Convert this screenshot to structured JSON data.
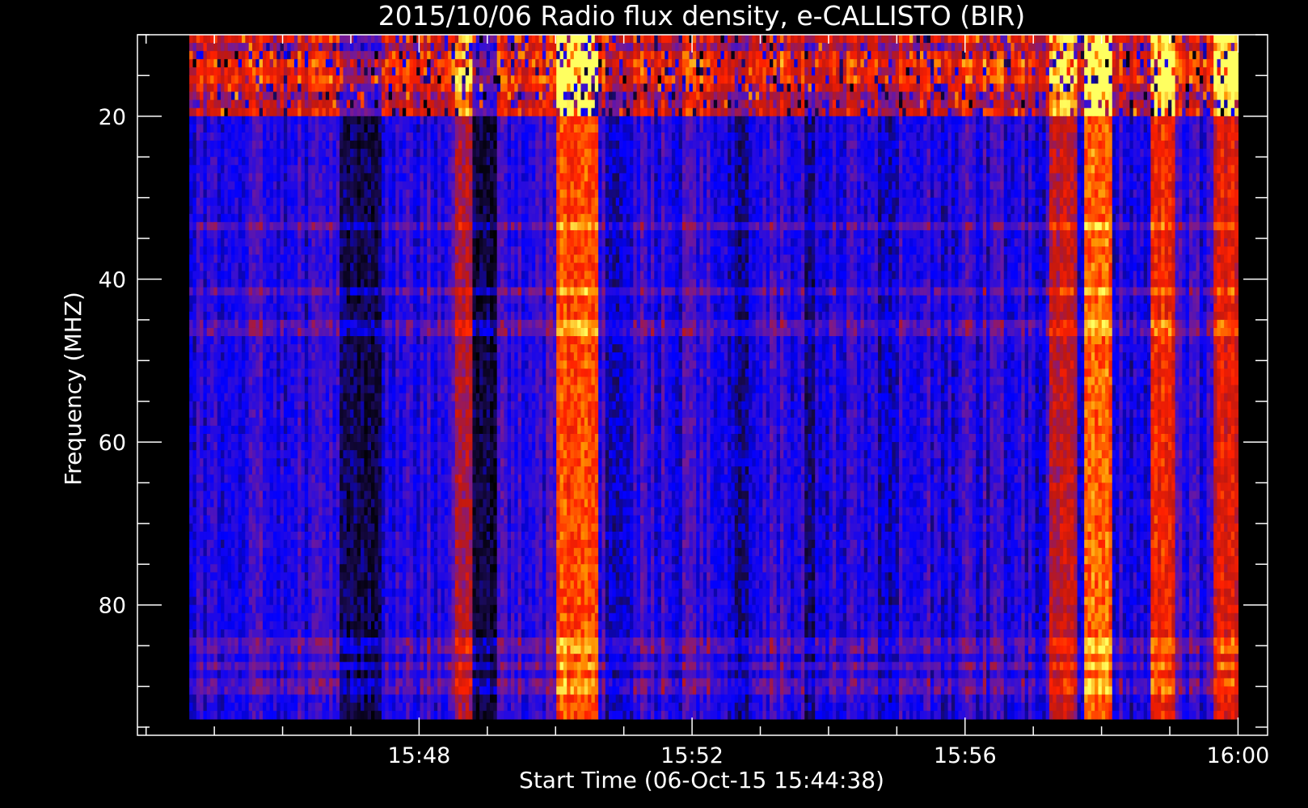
{
  "chart_data": {
    "type": "heatmap",
    "title": "2015/10/06  Radio flux density, e-CALLISTO (BIR)",
    "xlabel": "Start Time (06-Oct-15 15:44:38)",
    "ylabel": "Frequency (MHZ)",
    "x_ticks": [
      "15:48",
      "15:52",
      "15:56",
      "16:00"
    ],
    "y_ticks": [
      "20",
      "40",
      "60",
      "80"
    ],
    "y_tick_values": [
      20,
      40,
      60,
      80
    ],
    "x_tick_minutes": [
      3.367,
      7.367,
      11.367,
      15.367
    ],
    "xlim_minutes_after_start": [
      -0.76,
      15.8
    ],
    "ylim_mhz": [
      10,
      96
    ],
    "data_extent_mhz": [
      10,
      94
    ],
    "y_inverted": true,
    "colormap": [
      "#000000",
      "#1a0a55",
      "#0000ff",
      "#3a10d0",
      "#7a1a90",
      "#c01810",
      "#ff2000",
      "#ff9000",
      "#ffff60"
    ],
    "background_color": "#000000",
    "axis_color": "#ffffff",
    "bright_time_bands": [
      {
        "start_min": 5.4,
        "end_min": 6.0,
        "level": 0.78
      },
      {
        "start_min": 13.1,
        "end_min": 13.5,
        "level": 0.82
      },
      {
        "start_min": 14.1,
        "end_min": 14.45,
        "level": 0.72
      },
      {
        "start_min": 12.6,
        "end_min": 13.0,
        "level": 0.62
      },
      {
        "start_min": 15.0,
        "end_min": 15.4,
        "level": 0.68
      },
      {
        "start_min": 3.9,
        "end_min": 4.2,
        "level": 0.6
      }
    ],
    "dark_time_bands": [
      {
        "start_min": 2.2,
        "end_min": 2.8,
        "level": 0.08
      },
      {
        "start_min": 4.15,
        "end_min": 4.5,
        "level": 0.05
      },
      {
        "start_min": 6.1,
        "end_min": 6.5,
        "level": 0.18
      },
      {
        "start_min": 8.0,
        "end_min": 8.2,
        "level": 0.12
      },
      {
        "start_min": 9.0,
        "end_min": 9.15,
        "level": 0.12
      },
      {
        "start_min": 10.1,
        "end_min": 10.4,
        "level": 0.18
      }
    ],
    "horizontal_lines_mhz": [
      33.5,
      41.5,
      46,
      85,
      87.5,
      90
    ]
  }
}
